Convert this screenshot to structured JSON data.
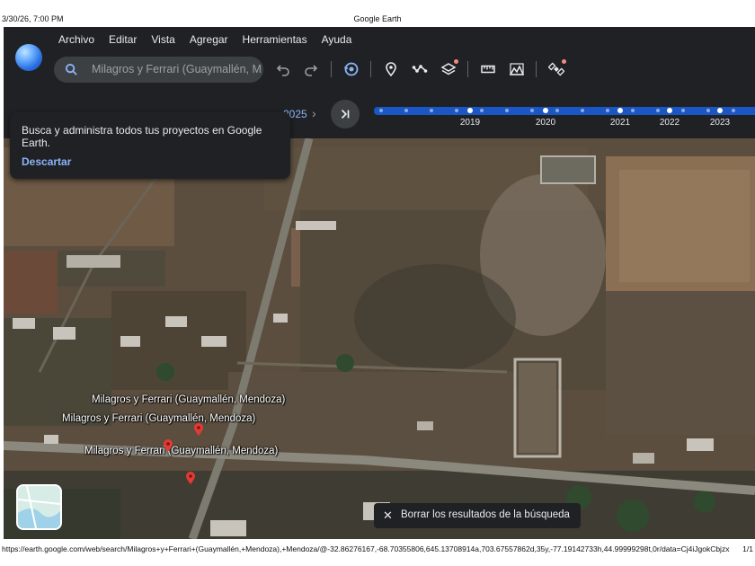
{
  "print": {
    "datetime": "3/30/26, 7:00 PM",
    "title": "Google Earth",
    "url": "https://earth.google.com/web/search/Milagros+y+Ferrari+(Guaymallén,+Mendoza),+Mendoza/@-32.86276167,-68.70355806,645.13708914a,703.67557862d,35y,-77.19142733h,44.99999298t,0r/data=Cj4iJgokCbjzx...",
    "page": "1/1"
  },
  "menu": [
    "Archivo",
    "Editar",
    "Vista",
    "Agregar",
    "Herramientas",
    "Ayuda"
  ],
  "search": {
    "value": "Milagros y Ferrari (Guaymallén, M"
  },
  "toolbar": {
    "icons": [
      "undo-icon",
      "redo-icon",
      "history-icon",
      "placemark-icon",
      "path-icon",
      "layers-icon",
      "measure-icon",
      "map-style-icon",
      "satellite-icon"
    ]
  },
  "timeline": {
    "current_year_partial": "2025",
    "years": [
      "2019",
      "2020",
      "2021",
      "2022",
      "2023"
    ]
  },
  "tooltip": {
    "text": "Busca y administra todos tus proyectos en Google Earth.",
    "dismiss": "Descartar"
  },
  "map": {
    "labels": [
      "Milagros y Ferrari (Guaymallén, Mendoza)",
      "Milagros y Ferrari (Guaymallén, Mendoza)",
      "Milagros y Ferrari (Guaymallén, Mendoza)"
    ],
    "pin_color": "#e53935"
  },
  "toast": {
    "text": "Borrar los resultados de la búsqueda"
  },
  "colors": {
    "accent": "#8ab4f8",
    "timeline": "#1a56c4",
    "toolbar_bg": "#202124"
  }
}
